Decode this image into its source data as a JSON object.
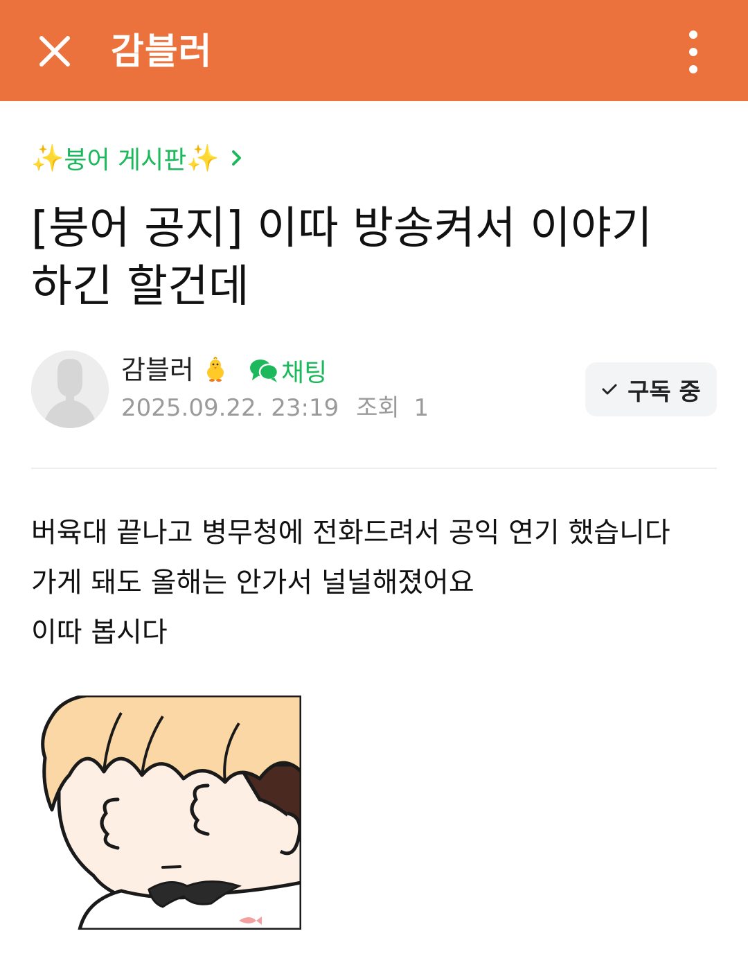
{
  "header": {
    "title": "감블러",
    "close_icon": "close-icon",
    "more_icon": "more-vertical-icon",
    "background_color": "#EC723D"
  },
  "board": {
    "sparkle_left": "✨",
    "name": "붕어 게시판",
    "sparkle_right": "✨",
    "chevron_icon": "chevron-right-icon",
    "color": "#1BB95B"
  },
  "post": {
    "title": "[붕어 공지] 이따 방송켜서 이야기 하긴 할건데",
    "author": {
      "name": "감블러",
      "badge_icon": "chick-icon",
      "avatar_icon": "default-avatar-icon"
    },
    "chat": {
      "label": "채팅",
      "icon": "chat-bubble-icon"
    },
    "date": "2025.09.22. 23:19",
    "views_label": "조회",
    "views": "1",
    "subscribe": {
      "label": "구독 중",
      "icon": "check-icon"
    },
    "body_lines": [
      "버육대 끝나고 병무청에 전화드려서 공익 연기 했습니다",
      "가게 돼도 올해는 안가서 널널해졌어요",
      "이따 봅시다"
    ],
    "image": "cartoon-character-illustration"
  }
}
